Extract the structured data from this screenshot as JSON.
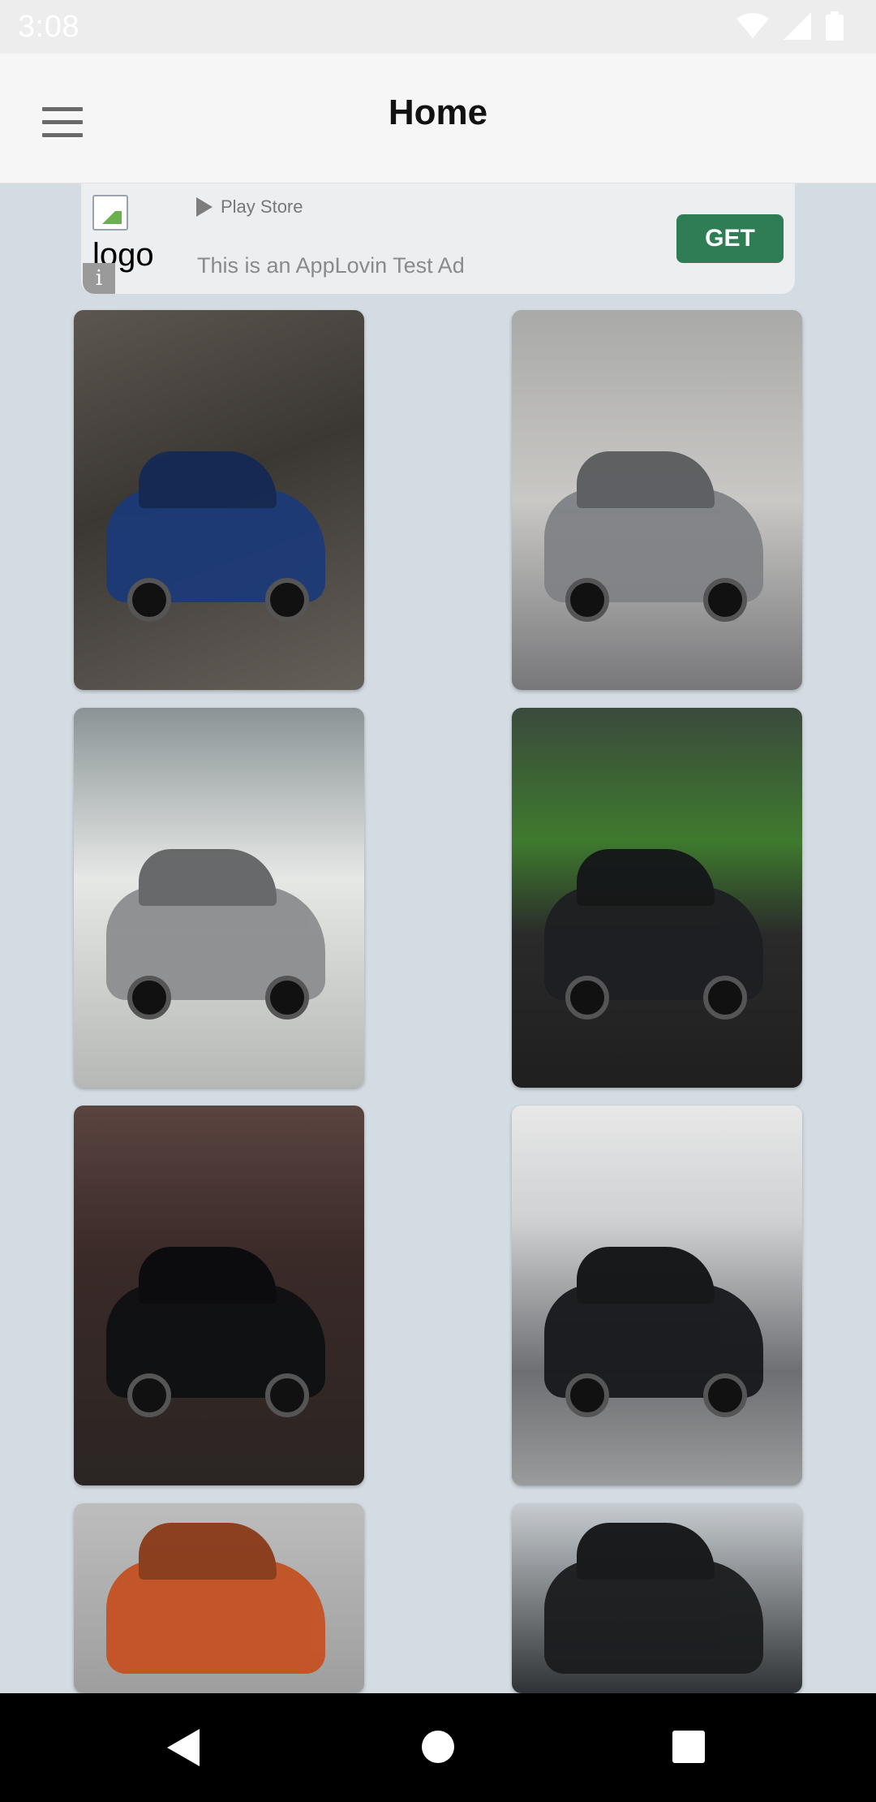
{
  "status_bar": {
    "time": "3:08",
    "icons": [
      "wifi-icon",
      "signal-icon",
      "battery-icon"
    ]
  },
  "app_bar": {
    "title": "Home",
    "menu_icon": "hamburger-menu-icon"
  },
  "ad": {
    "logo_alt": "logo",
    "store": "Play Store",
    "description": "This is an AppLovin Test Ad",
    "cta": "GET",
    "info_glyph": "i",
    "cta_color": "#2e7d54"
  },
  "wallpapers": [
    {
      "bg": "linear-gradient(160deg,#5d5650 0%,#3b3733 45%,#66605a 100%)",
      "car": "#1c3a78",
      "partial": false
    },
    {
      "bg": "linear-gradient(180deg,#a9a9a7 0%,#c9c8c5 50%,#77777a 100%)",
      "car": "#7f8286",
      "partial": false
    },
    {
      "bg": "linear-gradient(180deg,#8a9496 0%,#e6e8e6 45%,#b6b8b6 100%)",
      "car": "#8c8d8f",
      "partial": false
    },
    {
      "bg": "linear-gradient(180deg,#3b4a3c 0%,#3e7a2e 35%,#2a2a2a 60%,#1f1f1f 100%)",
      "car": "#1e1f22",
      "partial": false
    },
    {
      "bg": "linear-gradient(180deg,#5a4440 0%,#3a2a28 40%,#2b2523 100%)",
      "car": "#0f1012",
      "partial": false
    },
    {
      "bg": "linear-gradient(180deg,#e8e8e8 0%,#cfd1d3 30%,#6d6f72 70%,#9a9b9d 100%)",
      "car": "#16181b",
      "partial": false
    },
    {
      "bg": "linear-gradient(180deg,#bdbdbd 0%,#9e9e9e 100%)",
      "car": "#c45222",
      "partial": true
    },
    {
      "bg": "linear-gradient(180deg,#c7ccd0 0%,#2f3336 100%)",
      "car": "#1a1c1e",
      "partial": true
    }
  ],
  "nav_bar": {
    "back_icon": "back-triangle-icon",
    "home_icon": "home-circle-icon",
    "recents_icon": "recents-square-icon"
  }
}
